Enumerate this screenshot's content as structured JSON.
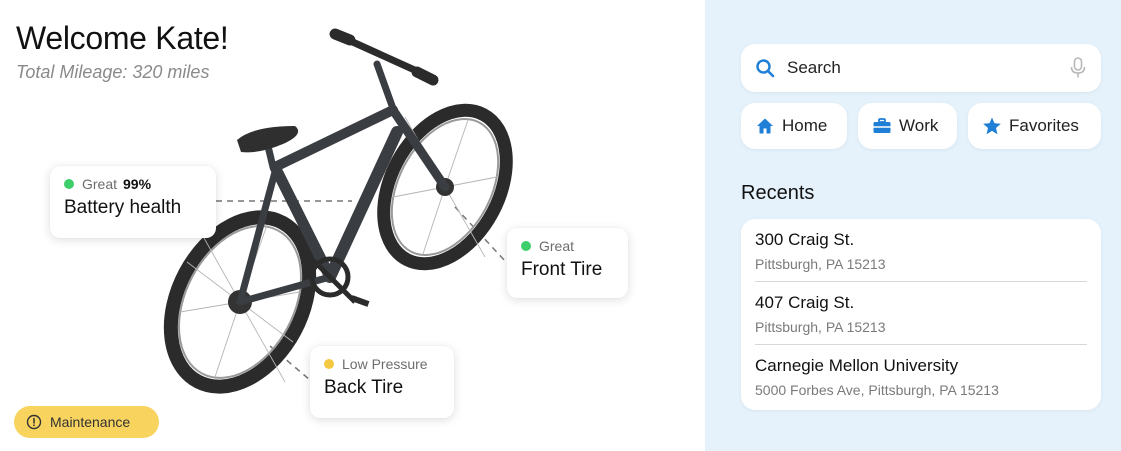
{
  "header": {
    "welcome": "Welcome Kate!",
    "mileage": "Total Mileage: 320 miles"
  },
  "status_cards": {
    "battery": {
      "status": "Great",
      "percent": "99%",
      "label": "Battery health",
      "dot_color": "#3ccf6a"
    },
    "front_tire": {
      "status": "Great",
      "label": "Front Tire",
      "dot_color": "#3ccf6a"
    },
    "back_tire": {
      "status": "Low Pressure",
      "label": "Back Tire",
      "dot_color": "#f5c842"
    }
  },
  "maintenance": {
    "label": "Maintenance",
    "icon": "alert-circle-icon",
    "color": "#f8d35e"
  },
  "search": {
    "placeholder": "Search",
    "icon": "search-icon",
    "mic_icon": "microphone-icon"
  },
  "quick_links": [
    {
      "label": "Home",
      "icon": "home-icon"
    },
    {
      "label": "Work",
      "icon": "briefcase-icon"
    },
    {
      "label": "Favorites",
      "icon": "star-icon"
    }
  ],
  "recents": {
    "title": "Recents",
    "items": [
      {
        "name": "300 Craig St.",
        "address": "Pittsburgh, PA 15213"
      },
      {
        "name": "407 Craig St.",
        "address": "Pittsburgh, PA 15213"
      },
      {
        "name": "Carnegie Mellon University",
        "address": "5000 Forbes Ave, Pittsburgh, PA 15213"
      }
    ]
  },
  "colors": {
    "accent": "#1f7fd6",
    "panel_bg": "#e6f2fb",
    "good": "#3ccf6a",
    "warn": "#f5c842"
  }
}
